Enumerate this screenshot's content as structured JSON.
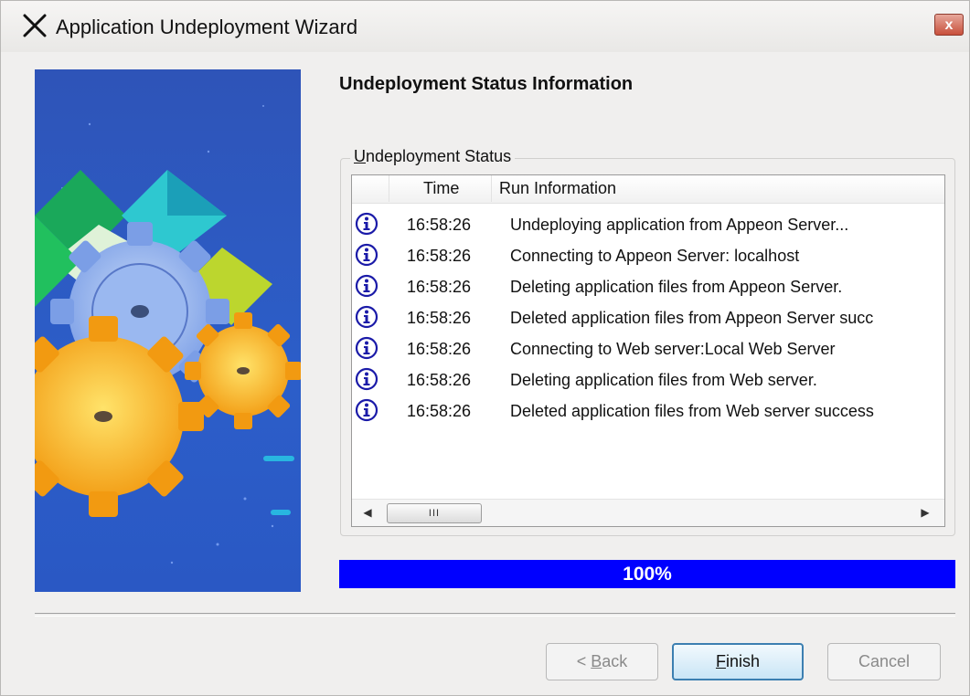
{
  "window": {
    "title": "Application Undeployment Wizard",
    "close_label": "x"
  },
  "page": {
    "heading": "Undeployment Status Information"
  },
  "status_group": {
    "label_prefix": "",
    "label_accel": "U",
    "label_rest": "ndeployment Status"
  },
  "log": {
    "columns": [
      "Time",
      "Run Information"
    ],
    "rows": [
      {
        "time": "16:58:26",
        "message": "Undeploying application from Appeon Server..."
      },
      {
        "time": "16:58:26",
        "message": "Connecting to Appeon Server: localhost"
      },
      {
        "time": "16:58:26",
        "message": "Deleting application files from Appeon Server."
      },
      {
        "time": "16:58:26",
        "message": "Deleted application files from Appeon Server succ"
      },
      {
        "time": "16:58:26",
        "message": "Connecting to Web server:Local Web Server"
      },
      {
        "time": "16:58:26",
        "message": "Deleting application files from Web server."
      },
      {
        "time": "16:58:26",
        "message": "Deleted application files from Web server success"
      }
    ],
    "scroll_thumb": "III"
  },
  "progress": {
    "value": 100,
    "label": "100%",
    "color": "#0000ff"
  },
  "buttons": {
    "back": {
      "prefix": "< ",
      "accel": "B",
      "rest": "ack"
    },
    "finish": {
      "accel": "F",
      "rest": "inish"
    },
    "cancel": "Cancel"
  },
  "icons": {
    "app": "wizard-x-icon",
    "row": "info-icon"
  }
}
